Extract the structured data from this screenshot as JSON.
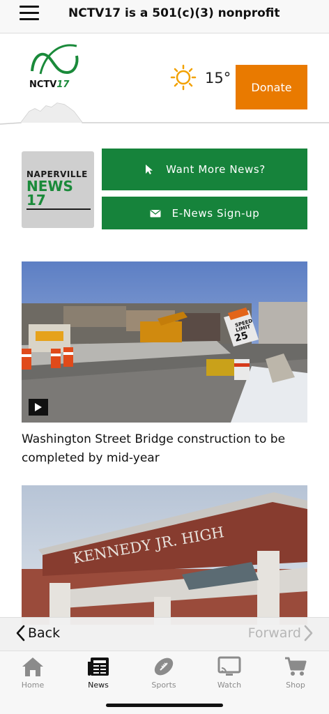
{
  "topbar": {
    "title": "NCTV17 is a 501(c)(3) nonprofit"
  },
  "header": {
    "logo_text": "NCTV",
    "logo_number": "17",
    "temperature": "15°",
    "donate_label": "Donate"
  },
  "promo": {
    "logo_line1": "NAPERVILLE",
    "logo_line2_word": "NEWS",
    "logo_line2_num": "17",
    "more_news_label": "Want More News?",
    "enews_label": "E-News Sign-up"
  },
  "articles": [
    {
      "title": "Washington Street Bridge construction to be completed by mid-year",
      "sign_text_1": "SPEED",
      "sign_text_2": "LIMIT",
      "sign_text_3": "25"
    },
    {
      "sign_text": "KENNEDY JR. HIGH"
    }
  ],
  "browser_nav": {
    "back_label": "Back",
    "forward_label": "Forward"
  },
  "tabs": [
    {
      "label": "Home",
      "icon": "home-icon"
    },
    {
      "label": "News",
      "icon": "newspaper-icon",
      "active": true
    },
    {
      "label": "Sports",
      "icon": "football-icon"
    },
    {
      "label": "Watch",
      "icon": "tv-icon"
    },
    {
      "label": "Shop",
      "icon": "cart-icon"
    }
  ],
  "colors": {
    "green": "#16833b",
    "orange": "#e97a00",
    "logo_green": "#1a8a3a"
  }
}
